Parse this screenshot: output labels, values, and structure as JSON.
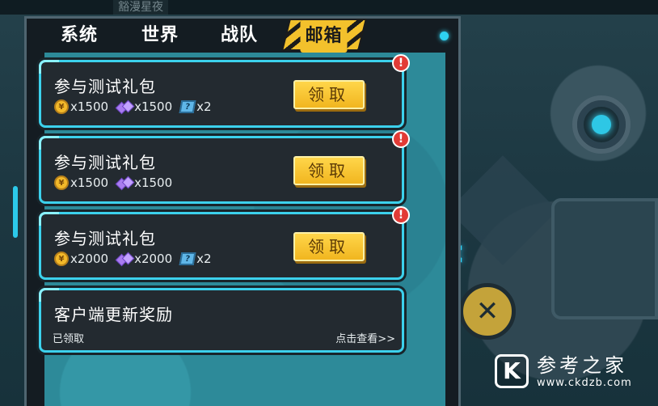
{
  "top_tag": "豁漫星夜",
  "tabs": [
    {
      "label": "系统"
    },
    {
      "label": "世界"
    },
    {
      "label": "战队"
    },
    {
      "label": "邮箱",
      "active": true
    }
  ],
  "mails": [
    {
      "title": "参与测试礼包",
      "rewards": [
        {
          "icon": "coin-icon",
          "text": "x1500"
        },
        {
          "icon": "gem-icon",
          "text": "x1500"
        },
        {
          "icon": "ticket-icon",
          "text": "x2"
        }
      ],
      "button": "领取",
      "alert": "!"
    },
    {
      "title": "参与测试礼包",
      "rewards": [
        {
          "icon": "coin-icon",
          "text": "x1500"
        },
        {
          "icon": "gem-icon",
          "text": "x1500"
        }
      ],
      "button": "领取",
      "alert": "!"
    },
    {
      "title": "参与测试礼包",
      "rewards": [
        {
          "icon": "coin-icon",
          "text": "x2000"
        },
        {
          "icon": "gem-icon",
          "text": "x2000"
        },
        {
          "icon": "ticket-icon",
          "text": "x2"
        }
      ],
      "button": "领取",
      "alert": "!"
    },
    {
      "title": "客户端更新奖励",
      "status": "已领取",
      "link": "点击查看>>"
    }
  ],
  "coin_symbol": "¥",
  "ticket_symbol": "?",
  "watermark": {
    "logo": "K",
    "name": "参考之家",
    "url": "www.ckdzb.com"
  },
  "colors": {
    "accent": "#3cd1ec",
    "button": "#f3c12c",
    "alert": "#e23b36",
    "panel_bg": "#2d8a99"
  }
}
